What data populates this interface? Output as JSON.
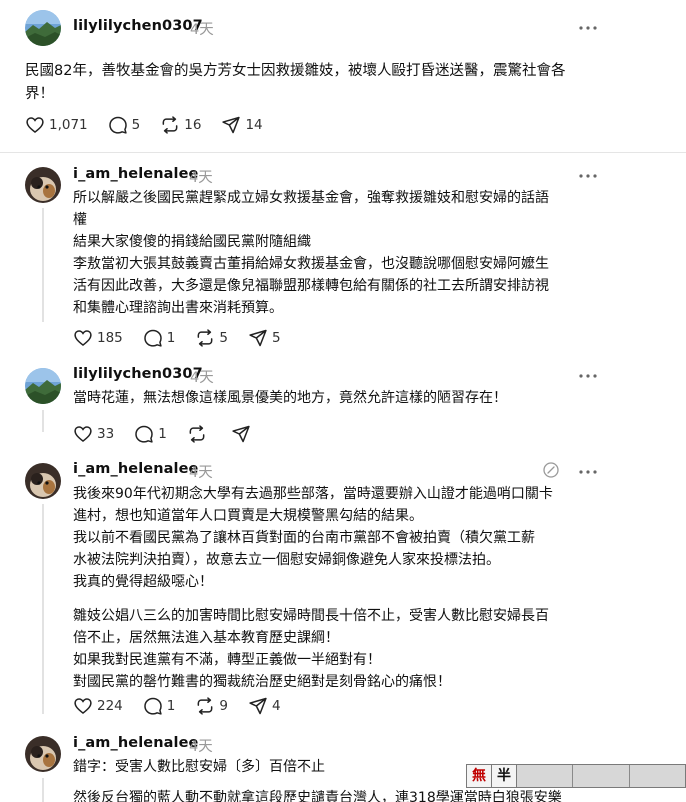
{
  "colors": {
    "text": "#101010",
    "muted": "#999999",
    "ime_accent": "#c00000"
  },
  "posts": [
    {
      "username": "lilylilychen0307",
      "time": "4天",
      "lines": [
        "民國82年，善牧基金會的吳方芳女士因救援雛妓，被壞人毆打昏迷送醫，震驚社會各",
        "界！"
      ],
      "likes": "1,071",
      "comments": "5",
      "reposts": "16",
      "shares": "14"
    },
    {
      "username": "i_am_helenalee",
      "time": "4天",
      "lines": [
        "所以解嚴之後國民黨趕緊成立婦女救援基金會，強奪救援雛妓和慰安婦的話語",
        "權",
        "結果大家傻傻的捐錢給國民黨附隨組織",
        "李敖當初大張其鼓義賣古董捐給婦女救援基金會，也沒聽說哪個慰安婦阿嬤生",
        "活有因此改善，大多還是像兒福聯盟那樣轉包給有關係的社工去所謂安排訪視",
        "和集體心理諮詢出書來消耗預算。"
      ],
      "likes": "185",
      "comments": "1",
      "reposts": "5",
      "shares": "5"
    },
    {
      "username": "lilylilychen0307",
      "time": "4天",
      "lines": [
        "當時花蓮，無法想像這樣風景優美的地方，竟然允許這樣的陋習存在！"
      ],
      "likes": "33",
      "comments": "1",
      "reposts": "",
      "shares": ""
    },
    {
      "username": "i_am_helenalee",
      "time": "4天",
      "lines": [
        "我後來90年代初期念大學有去過那些部落，當時還要辦入山證才能過哨口關卡",
        "進村，想也知道當年人口買賣是大規模警黑勾結的結果。",
        "我以前不看國民黨為了讓林百貨對面的台南市黨部不會被拍賣（積欠黨工薪",
        "水被法院判決拍賣），故意去立一個慰安婦銅像避免人家來投標法拍。",
        "我真的覺得超級噁心！"
      ],
      "lines2": [
        "雛妓公娼八三么的加害時間比慰安婦時間長十倍不止，受害人數比慰安婦長百",
        "倍不止，居然無法進入基本教育歷史課綱！",
        "如果我對民進黨有不滿，轉型正義做一半絕對有！",
        "對國民黨的罄竹難書的獨裁統治歷史絕對是刻骨銘心的痛恨！"
      ],
      "likes": "224",
      "comments": "1",
      "reposts": "9",
      "shares": "4"
    },
    {
      "username": "i_am_helenalee",
      "time": "4天",
      "lines": [
        "錯字：受害人數比慰安婦〔多〕百倍不止",
        "然後反台獨的藍人動不動就拿這段歷史譴責台灣人，連318學運當時白狼張安樂"
      ]
    }
  ],
  "ime": {
    "key1": "無",
    "key2": "半"
  }
}
